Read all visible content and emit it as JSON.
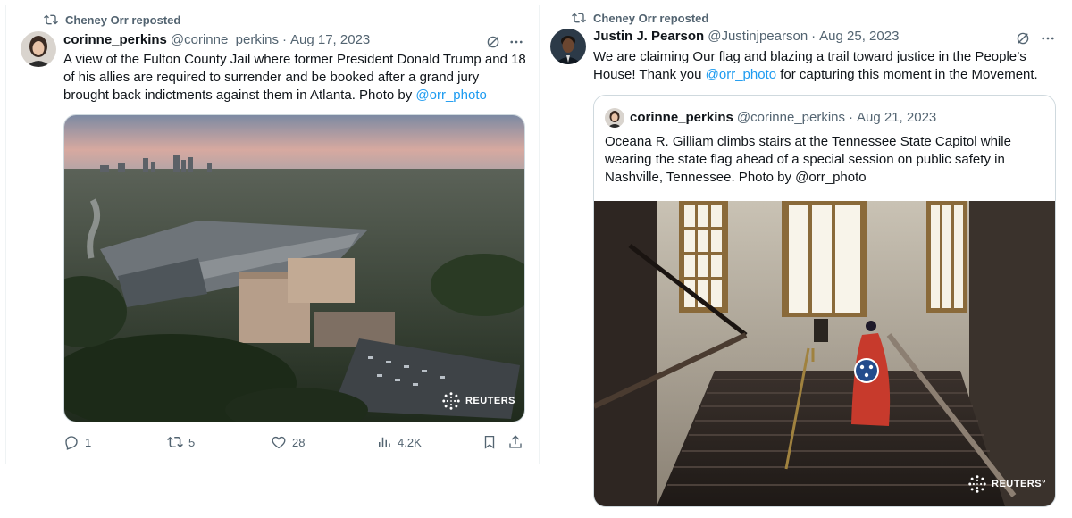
{
  "left": {
    "repost_label": "Cheney Orr reposted",
    "author_name": "corinne_perkins",
    "author_handle": "@corinne_perkins",
    "separator": "·",
    "date": "Aug 17, 2023",
    "text": "A view of the Fulton County Jail where former President Donald Trump and 18 of his allies are required to surrender and be booked after a grand jury brought back indictments against them in Atlanta. Photo by ",
    "text_link": "@orr_photo",
    "watermark": "REUTERS",
    "actions": {
      "replies": "1",
      "reposts": "5",
      "likes": "28",
      "views": "4.2K"
    }
  },
  "right": {
    "repost_label": "Cheney Orr reposted",
    "author_name": "Justin J. Pearson",
    "author_handle": "@Justinjpearson",
    "separator": "·",
    "date": "Aug 25, 2023",
    "text_before": "We are claiming Our flag and blazing a trail toward justice in the People’s House! Thank you ",
    "text_link": "@orr_photo",
    "text_after": " for capturing this moment in the Movement.",
    "quote": {
      "author_name": "corinne_perkins",
      "author_handle": "@corinne_perkins",
      "separator": "·",
      "date": "Aug 21, 2023",
      "text": "Oceana R. Gilliam climbs stairs at the Tennessee State Capitol while wearing the state flag ahead of a special session on public safety in Nashville, Tennessee. Photo by @orr_photo",
      "watermark": "REUTERS°"
    }
  },
  "icons": {
    "repost": "repost-icon",
    "grok": "grok-icon",
    "more": "more-icon",
    "reply": "reply-icon",
    "like": "heart-icon",
    "views": "views-icon",
    "bookmark": "bookmark-icon",
    "share": "share-icon"
  },
  "colors": {
    "link": "#1d9bf0",
    "muted": "#536471",
    "text": "#0f1419"
  }
}
